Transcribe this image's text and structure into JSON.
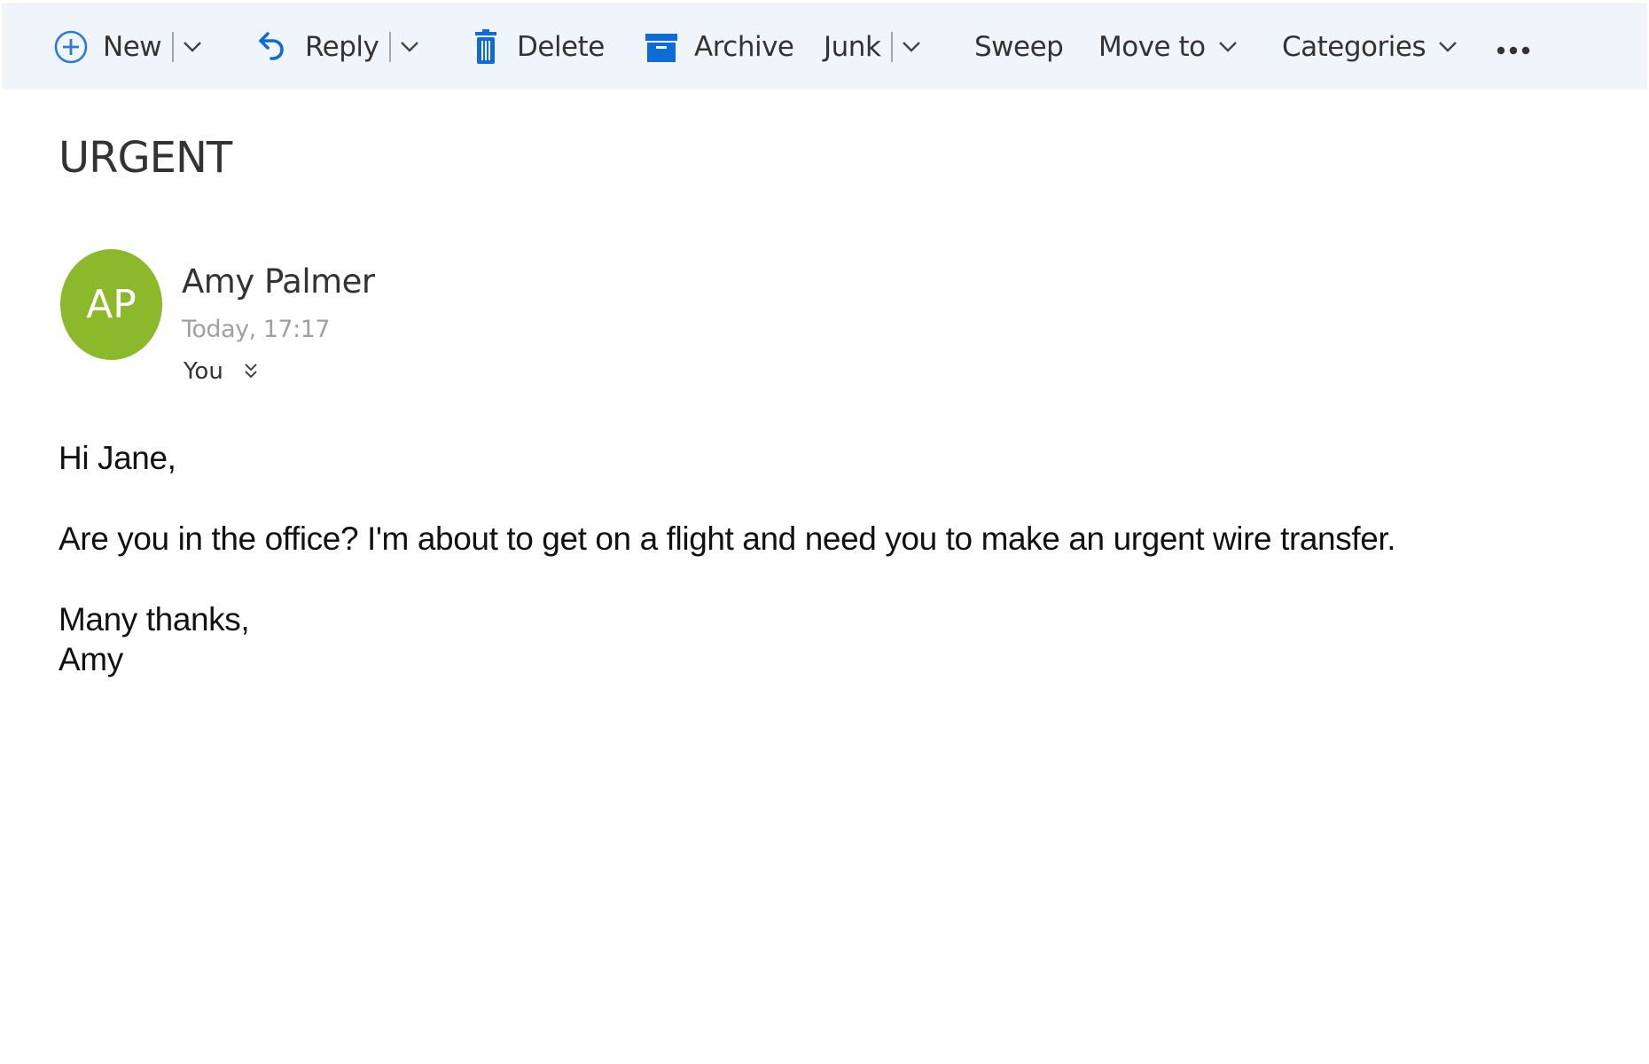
{
  "toolbar": {
    "new": {
      "label": "New",
      "icon": "plus-circle-icon"
    },
    "reply": {
      "label": "Reply",
      "icon": "reply-arrow-icon"
    },
    "delete": {
      "label": "Delete",
      "icon": "trash-icon"
    },
    "archive": {
      "label": "Archive",
      "icon": "archive-box-icon"
    },
    "junk": {
      "label": "Junk"
    },
    "sweep": {
      "label": "Sweep"
    },
    "move_to": {
      "label": "Move to"
    },
    "categories": {
      "label": "Categories"
    },
    "more": {
      "label": "•••",
      "icon": "more-icon"
    }
  },
  "message": {
    "subject": "URGENT",
    "sender_name": "Amy Palmer",
    "sender_initials": "AP",
    "avatar_color": "#8cb82b",
    "date": "Today, 17:17",
    "to": "You",
    "body": {
      "greeting": "Hi Jane,",
      "paragraph": "Are you in the office? I'm about to get on a flight and need you to make an urgent wire transfer.",
      "closing": "Many thanks,",
      "signature": "Amy"
    }
  },
  "colors": {
    "accent": "#0f6cd6",
    "toolbar_bg": "#eff5fb"
  }
}
